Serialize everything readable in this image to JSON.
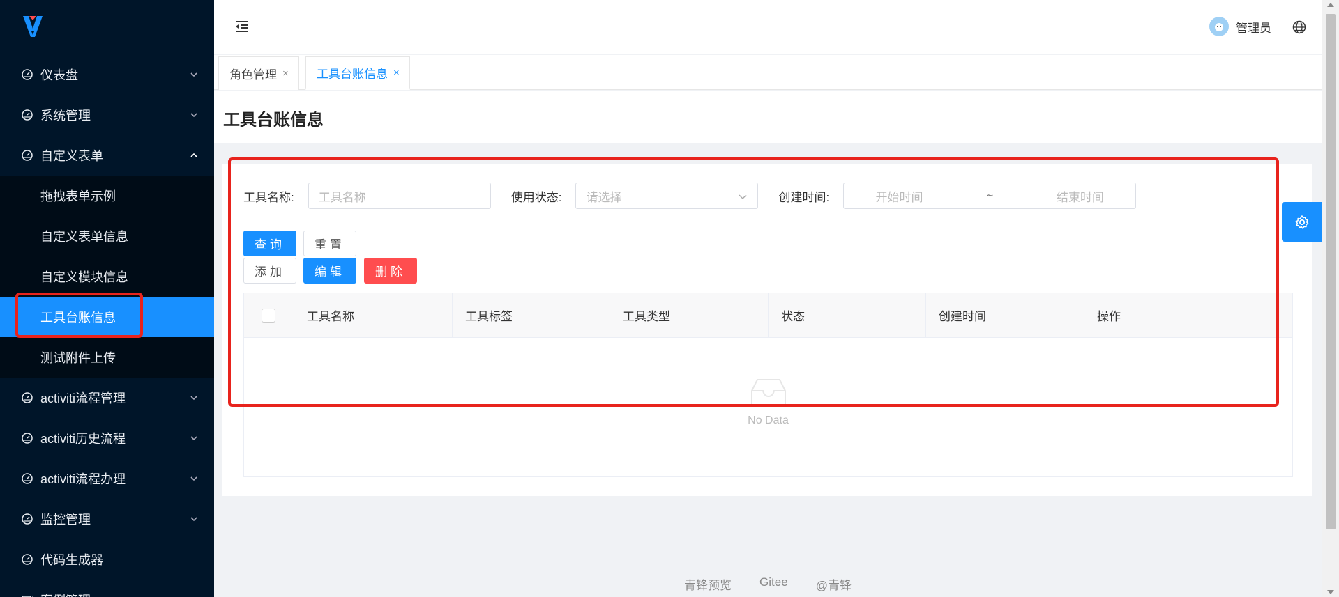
{
  "sidebar": {
    "items": [
      {
        "label": "仪表盘"
      },
      {
        "label": "系统管理"
      },
      {
        "label": "自定义表单"
      },
      {
        "label": "activiti流程管理"
      },
      {
        "label": "activiti历史流程"
      },
      {
        "label": "activiti流程办理"
      },
      {
        "label": "监控管理"
      },
      {
        "label": "代码生成器"
      },
      {
        "label": "案例管理"
      }
    ],
    "submenu": [
      {
        "label": "拖拽表单示例"
      },
      {
        "label": "自定义表单信息"
      },
      {
        "label": "自定义模块信息"
      },
      {
        "label": "工具台账信息",
        "active": true
      },
      {
        "label": "测试附件上传"
      }
    ]
  },
  "header": {
    "user_name": "管理员"
  },
  "tabs": [
    {
      "label": "角色管理",
      "close": "×"
    },
    {
      "label": "工具台账信息",
      "close": "×",
      "active": true
    }
  ],
  "page": {
    "title": "工具台账信息"
  },
  "form": {
    "tool_name_label": "工具名称:",
    "tool_name_placeholder": "工具名称",
    "status_label": "使用状态:",
    "status_placeholder": "请选择",
    "created_label": "创建时间:",
    "start_placeholder": "开始时间",
    "range_separator": "~",
    "end_placeholder": "结束时间"
  },
  "buttons": {
    "query": "查询",
    "reset": "重置",
    "add": "添加",
    "edit": "编辑",
    "delete": "删除"
  },
  "table": {
    "columns": [
      "工具名称",
      "工具标签",
      "工具类型",
      "状态",
      "创建时间",
      "操作"
    ],
    "empty_text": "No Data"
  },
  "footer": {
    "links": [
      "青锋预览",
      "Gitee",
      "@青锋"
    ]
  },
  "colors": {
    "sidebar_bg": "#001529",
    "primary": "#1890ff",
    "danger": "#ff4d4f",
    "highlight": "#e8231d"
  },
  "icons": {
    "logo": "logo-icon",
    "menu_fold": "menu-fold-icon",
    "globe": "globe-icon",
    "settings": "gear-icon"
  }
}
